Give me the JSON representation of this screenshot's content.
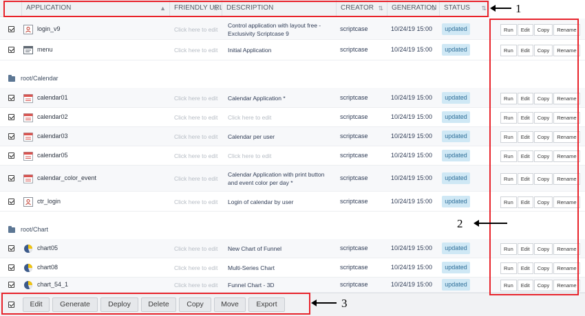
{
  "columns": {
    "application": "APPLICATION",
    "friendly_url": "FRIENDLY URL",
    "description": "DESCRIPTION",
    "creator": "CREATOR",
    "generation": "GENERATION",
    "status": "STATUS"
  },
  "action_labels": {
    "run": "Run",
    "edit": "Edit",
    "copy": "Copy",
    "rename": "Rename"
  },
  "rows_top": [
    {
      "name": "login_v9",
      "icon": "login-app-icon",
      "friendly": "Click here to edit",
      "desc": "Control application with layout free - Exclusivity Scriptcase 9",
      "desc_muted": false,
      "creator": "scriptcase",
      "generation": "10/24/19 15:00",
      "status": "updated"
    },
    {
      "name": "menu",
      "icon": "menu-app-icon",
      "friendly": "Click here to edit",
      "desc": "Initial Application",
      "desc_muted": false,
      "creator": "scriptcase",
      "generation": "10/24/19 15:00",
      "status": "updated"
    }
  ],
  "folders": {
    "calendar": "root/Calendar",
    "chart": "root/Chart"
  },
  "rows_calendar": [
    {
      "name": "calendar01",
      "icon": "calendar-app-icon",
      "friendly": "Click here to edit",
      "desc": "Calendar Application *",
      "desc_muted": false,
      "creator": "scriptcase",
      "generation": "10/24/19 15:00",
      "status": "updated"
    },
    {
      "name": "calendar02",
      "icon": "calendar-app-icon",
      "friendly": "Click here to edit",
      "desc": "Click here to edit",
      "desc_muted": true,
      "creator": "scriptcase",
      "generation": "10/24/19 15:00",
      "status": "updated"
    },
    {
      "name": "calendar03",
      "icon": "calendar-app-icon",
      "friendly": "Click here to edit",
      "desc": "Calendar per user",
      "desc_muted": false,
      "creator": "scriptcase",
      "generation": "10/24/19 15:00",
      "status": "updated"
    },
    {
      "name": "calendar05",
      "icon": "calendar-app-icon",
      "friendly": "Click here to edit",
      "desc": "Click here to edit",
      "desc_muted": true,
      "creator": "scriptcase",
      "generation": "10/24/19 15:00",
      "status": "updated"
    },
    {
      "name": "calendar_color_event",
      "icon": "calendar-app-icon",
      "friendly": "Click here to edit",
      "desc": "Calendar Application with print button and event color per day *",
      "desc_muted": false,
      "creator": "scriptcase",
      "generation": "10/24/19 15:00",
      "status": "updated"
    },
    {
      "name": "ctr_login",
      "icon": "login-app-icon",
      "friendly": "Click here to edit",
      "desc": "Login of calendar by user",
      "desc_muted": false,
      "creator": "scriptcase",
      "generation": "10/24/19 15:00",
      "status": "updated"
    }
  ],
  "rows_chart": [
    {
      "name": "chart05",
      "icon": "chart-app-icon",
      "friendly": "Click here to edit",
      "desc": "New Chart of Funnel",
      "desc_muted": false,
      "creator": "scriptcase",
      "generation": "10/24/19 15:00",
      "status": "updated"
    },
    {
      "name": "chart08",
      "icon": "chart-app-icon",
      "friendly": "Click here to edit",
      "desc": "Multi-Series Chart",
      "desc_muted": false,
      "creator": "scriptcase",
      "generation": "10/24/19 15:00",
      "status": "updated"
    },
    {
      "name": "chart_54_1",
      "icon": "chart-app-icon",
      "friendly": "Click here to edit",
      "desc": "Funnel Chart - 3D",
      "desc_muted": false,
      "creator": "scriptcase",
      "generation": "10/24/19 15:00",
      "status": "updated"
    }
  ],
  "footer": {
    "edit": "Edit",
    "generate": "Generate",
    "deploy": "Deploy",
    "delete": "Delete",
    "copy": "Copy",
    "move": "Move",
    "export": "Export"
  },
  "callouts": {
    "one": "1",
    "two": "2",
    "three": "3"
  },
  "colors": {
    "highlight": "#e8222a",
    "status_bg": "#cfe8f5",
    "status_text": "#2f6f99"
  }
}
